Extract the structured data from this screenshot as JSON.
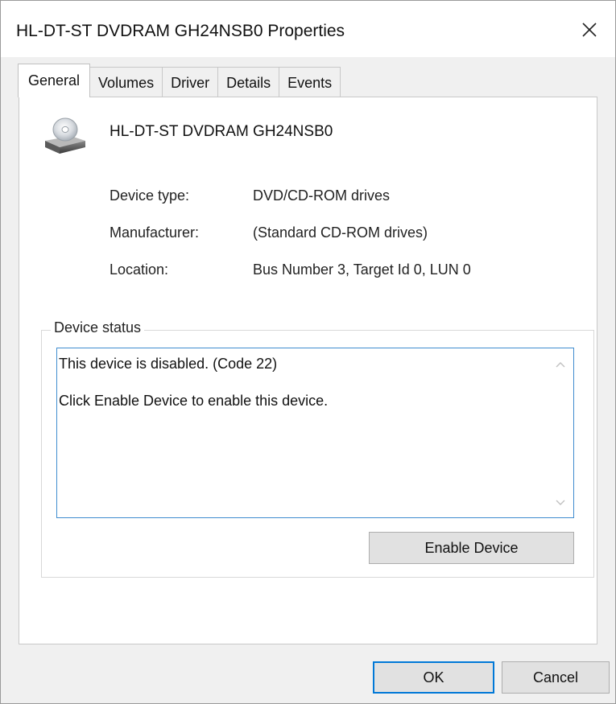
{
  "window": {
    "title": "HL-DT-ST DVDRAM GH24NSB0 Properties"
  },
  "tabs": [
    {
      "label": "General",
      "active": true
    },
    {
      "label": "Volumes",
      "active": false
    },
    {
      "label": "Driver",
      "active": false
    },
    {
      "label": "Details",
      "active": false
    },
    {
      "label": "Events",
      "active": false
    }
  ],
  "device": {
    "name": "HL-DT-ST DVDRAM GH24NSB0",
    "icon": "optical-drive-icon"
  },
  "properties": [
    {
      "label": "Device type:",
      "value": "DVD/CD-ROM drives"
    },
    {
      "label": "Manufacturer:",
      "value": "(Standard CD-ROM drives)"
    },
    {
      "label": "Location:",
      "value": "Bus Number 3, Target Id 0, LUN 0"
    }
  ],
  "device_status": {
    "legend": "Device status",
    "line1": "This device is disabled. (Code 22)",
    "line2": "Click Enable Device to enable this device."
  },
  "buttons": {
    "enable": "Enable Device",
    "ok": "OK",
    "cancel": "Cancel"
  },
  "colors": {
    "focus_border": "#0078d7",
    "status_border": "#3f8ccf"
  }
}
